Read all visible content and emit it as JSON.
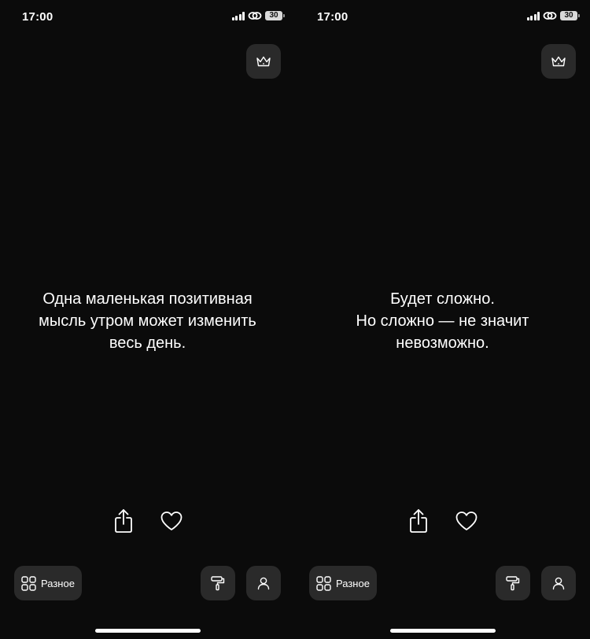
{
  "screens": [
    {
      "status_bar": {
        "time": "17:00",
        "battery": "30"
      },
      "quote_lines": [
        "Одна маленькая позитивная",
        "мысль утром может изменить",
        "весь день."
      ],
      "category": {
        "label": "Разное"
      }
    },
    {
      "status_bar": {
        "time": "17:00",
        "battery": "30"
      },
      "quote_lines": [
        "Будет сложно.",
        "Но сложно — не значит",
        "невозможно."
      ],
      "category": {
        "label": "Разное"
      }
    }
  ],
  "icons": {
    "premium": "crown-icon",
    "share": "share-icon",
    "like": "heart-icon",
    "category": "grid-icon",
    "theme": "paint-roller-icon",
    "profile": "user-icon",
    "signal": "signal-icon",
    "connection": "link-icon",
    "battery": "battery-icon"
  },
  "colors": {
    "background": "#0b0b0b",
    "button_bg": "#2a2a2a",
    "text": "#ffffff"
  }
}
